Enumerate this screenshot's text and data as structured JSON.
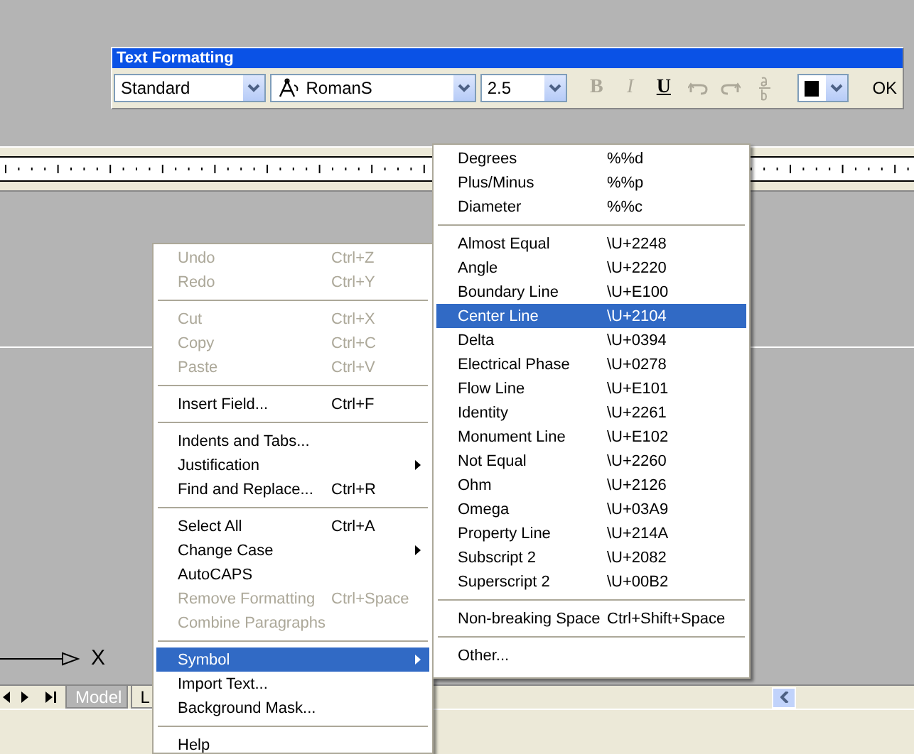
{
  "toolbar": {
    "title": "Text Formatting",
    "style": {
      "value": "Standard"
    },
    "font": {
      "value": "RomanS"
    },
    "height": {
      "value": "2.5"
    },
    "buttons": [
      {
        "kind": "bold",
        "label": "B",
        "disabled": true
      },
      {
        "kind": "italic",
        "label": "I",
        "disabled": true
      },
      {
        "kind": "underline",
        "label": "U",
        "disabled": false
      },
      {
        "kind": "undo",
        "disabled": true
      },
      {
        "kind": "redo",
        "disabled": true
      },
      {
        "kind": "stack",
        "disabled": true
      }
    ],
    "ok": "OK"
  },
  "canvas": {
    "axis_label": "X"
  },
  "layout_tabs": [
    {
      "label": "Model",
      "selected": true
    },
    {
      "label": "L",
      "selected": false
    }
  ],
  "context_menu": {
    "items": [
      {
        "kind": "item",
        "label": "Undo",
        "shortcut": "Ctrl+Z",
        "disabled": true,
        "submenu": false,
        "selected": false
      },
      {
        "kind": "item",
        "label": "Redo",
        "shortcut": "Ctrl+Y",
        "disabled": true,
        "submenu": false,
        "selected": false
      },
      {
        "kind": "separator"
      },
      {
        "kind": "item",
        "label": "Cut",
        "shortcut": "Ctrl+X",
        "disabled": true,
        "submenu": false,
        "selected": false
      },
      {
        "kind": "item",
        "label": "Copy",
        "shortcut": "Ctrl+C",
        "disabled": true,
        "submenu": false,
        "selected": false
      },
      {
        "kind": "item",
        "label": "Paste",
        "shortcut": "Ctrl+V",
        "disabled": true,
        "submenu": false,
        "selected": false
      },
      {
        "kind": "separator"
      },
      {
        "kind": "item",
        "label": "Insert Field...",
        "shortcut": "Ctrl+F",
        "disabled": false,
        "submenu": false,
        "selected": false
      },
      {
        "kind": "separator"
      },
      {
        "kind": "item",
        "label": "Indents and Tabs...",
        "disabled": false,
        "submenu": false,
        "selected": false
      },
      {
        "kind": "item",
        "label": "Justification",
        "disabled": false,
        "submenu": true,
        "selected": false
      },
      {
        "kind": "item",
        "label": "Find and Replace...",
        "shortcut": "Ctrl+R",
        "disabled": false,
        "submenu": false,
        "selected": false
      },
      {
        "kind": "separator"
      },
      {
        "kind": "item",
        "label": "Select All",
        "shortcut": "Ctrl+A",
        "disabled": false,
        "submenu": false,
        "selected": false
      },
      {
        "kind": "item",
        "label": "Change Case",
        "disabled": false,
        "submenu": true,
        "selected": false
      },
      {
        "kind": "item",
        "label": "AutoCAPS",
        "disabled": false,
        "submenu": false,
        "selected": false
      },
      {
        "kind": "item",
        "label": "Remove Formatting",
        "shortcut": "Ctrl+Space",
        "disabled": true,
        "submenu": false,
        "selected": false
      },
      {
        "kind": "item",
        "label": "Combine Paragraphs",
        "disabled": true,
        "submenu": false,
        "selected": false
      },
      {
        "kind": "separator"
      },
      {
        "kind": "item",
        "label": "Symbol",
        "disabled": false,
        "submenu": true,
        "selected": true
      },
      {
        "kind": "item",
        "label": "Import Text...",
        "disabled": false,
        "submenu": false,
        "selected": false
      },
      {
        "kind": "item",
        "label": "Background Mask...",
        "disabled": false,
        "submenu": false,
        "selected": false
      },
      {
        "kind": "separator"
      },
      {
        "kind": "item",
        "label": "Help",
        "disabled": false,
        "submenu": false,
        "selected": false
      }
    ]
  },
  "symbol_menu": {
    "items": [
      {
        "kind": "item",
        "label": "Degrees",
        "shortcut": "%%d",
        "disabled": false,
        "submenu": false,
        "selected": false
      },
      {
        "kind": "item",
        "label": "Plus/Minus",
        "shortcut": "%%p",
        "disabled": false,
        "submenu": false,
        "selected": false
      },
      {
        "kind": "item",
        "label": "Diameter",
        "shortcut": "%%c",
        "disabled": false,
        "submenu": false,
        "selected": false
      },
      {
        "kind": "separator"
      },
      {
        "kind": "item",
        "label": "Almost Equal",
        "shortcut": "\\U+2248",
        "disabled": false,
        "submenu": false,
        "selected": false
      },
      {
        "kind": "item",
        "label": "Angle",
        "shortcut": "\\U+2220",
        "disabled": false,
        "submenu": false,
        "selected": false
      },
      {
        "kind": "item",
        "label": "Boundary Line",
        "shortcut": "\\U+E100",
        "disabled": false,
        "submenu": false,
        "selected": false
      },
      {
        "kind": "item",
        "label": "Center Line",
        "shortcut": "\\U+2104",
        "disabled": false,
        "submenu": false,
        "selected": true
      },
      {
        "kind": "item",
        "label": "Delta",
        "shortcut": "\\U+0394",
        "disabled": false,
        "submenu": false,
        "selected": false
      },
      {
        "kind": "item",
        "label": "Electrical Phase",
        "shortcut": "\\U+0278",
        "disabled": false,
        "submenu": false,
        "selected": false
      },
      {
        "kind": "item",
        "label": "Flow Line",
        "shortcut": "\\U+E101",
        "disabled": false,
        "submenu": false,
        "selected": false
      },
      {
        "kind": "item",
        "label": "Identity",
        "shortcut": "\\U+2261",
        "disabled": false,
        "submenu": false,
        "selected": false
      },
      {
        "kind": "item",
        "label": "Monument Line",
        "shortcut": "\\U+E102",
        "disabled": false,
        "submenu": false,
        "selected": false
      },
      {
        "kind": "item",
        "label": "Not Equal",
        "shortcut": "\\U+2260",
        "disabled": false,
        "submenu": false,
        "selected": false
      },
      {
        "kind": "item",
        "label": "Ohm",
        "shortcut": "\\U+2126",
        "disabled": false,
        "submenu": false,
        "selected": false
      },
      {
        "kind": "item",
        "label": "Omega",
        "shortcut": "\\U+03A9",
        "disabled": false,
        "submenu": false,
        "selected": false
      },
      {
        "kind": "item",
        "label": "Property Line",
        "shortcut": "\\U+214A",
        "disabled": false,
        "submenu": false,
        "selected": false
      },
      {
        "kind": "item",
        "label": "Subscript 2",
        "shortcut": "\\U+2082",
        "disabled": false,
        "submenu": false,
        "selected": false
      },
      {
        "kind": "item",
        "label": "Superscript 2",
        "shortcut": "\\U+00B2",
        "disabled": false,
        "submenu": false,
        "selected": false
      },
      {
        "kind": "separator"
      },
      {
        "kind": "item",
        "label": "Non-breaking Space",
        "shortcut": "Ctrl+Shift+Space",
        "disabled": false,
        "submenu": false,
        "selected": false
      },
      {
        "kind": "separator"
      },
      {
        "kind": "item",
        "label": "Other...",
        "disabled": false,
        "submenu": false,
        "selected": false
      }
    ]
  }
}
